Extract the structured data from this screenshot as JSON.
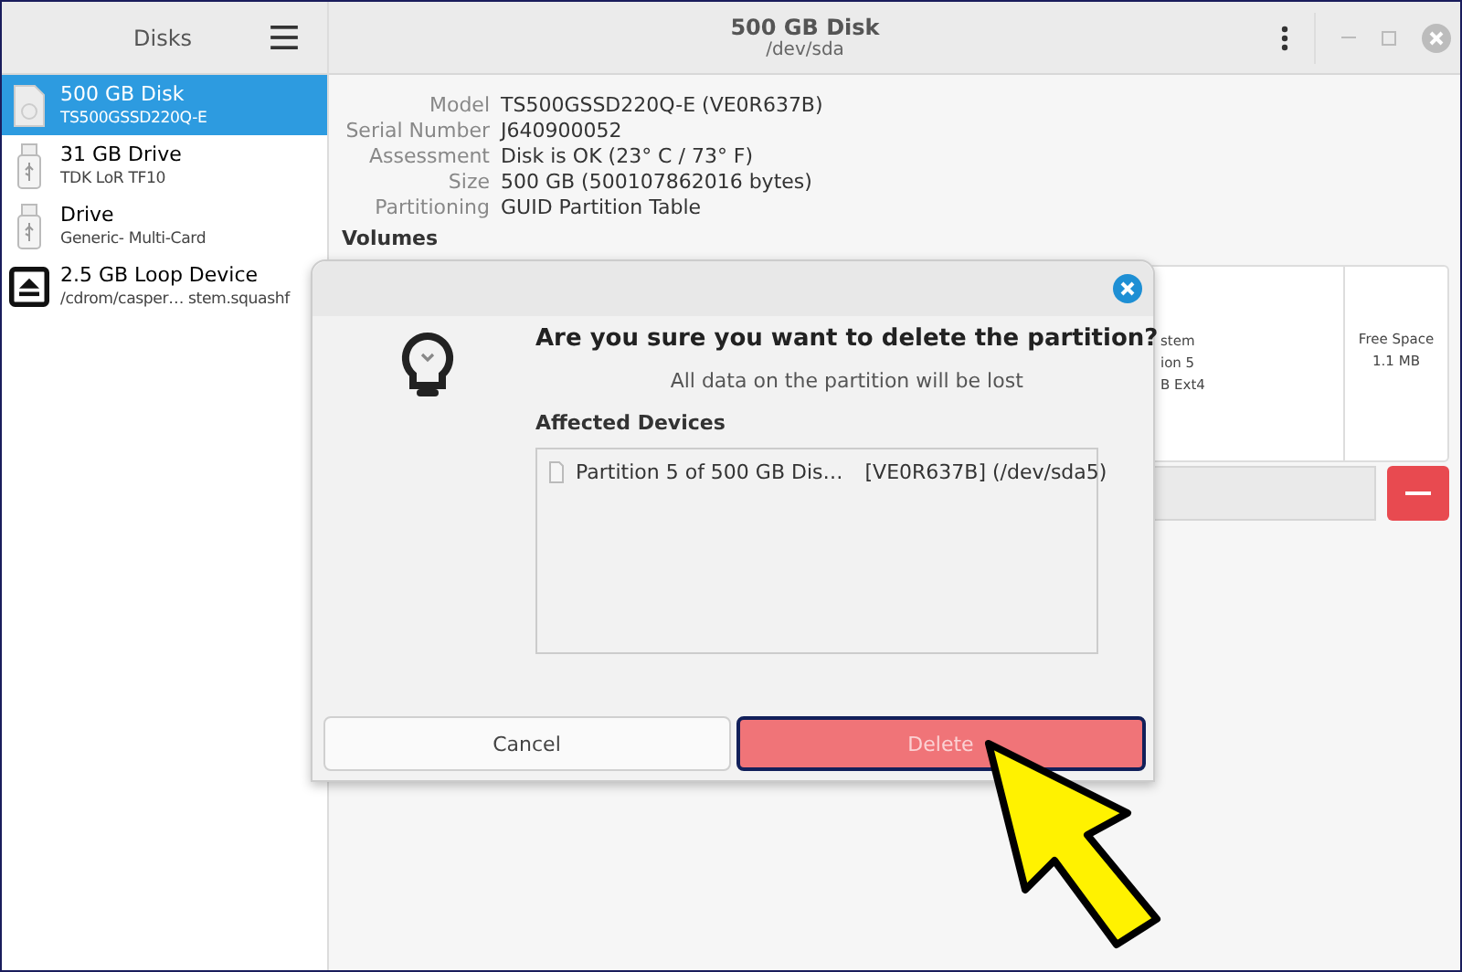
{
  "sidebar": {
    "title": "Disks",
    "items": [
      {
        "kind": "disk",
        "name": "500 GB Disk",
        "detail": "TS500GSSD220Q-E",
        "selected": true
      },
      {
        "kind": "usb",
        "name": "31 GB Drive",
        "detail": "TDK LoR TF10",
        "selected": false
      },
      {
        "kind": "usb",
        "name": "Drive",
        "detail": "Generic- Multi-Card",
        "selected": false
      },
      {
        "kind": "loop",
        "name": "2.5 GB Loop Device",
        "detail": "/cdrom/casper… stem.squashf",
        "selected": false
      }
    ]
  },
  "header": {
    "title": "500 GB Disk",
    "subtitle": "/dev/sda"
  },
  "details": [
    {
      "label": "Model",
      "value": "TS500GSSD220Q-E (VE0R637B)"
    },
    {
      "label": "Serial Number",
      "value": "J640900052"
    },
    {
      "label": "Assessment",
      "value": "Disk is OK (23° C / 73° F)"
    },
    {
      "label": "Size",
      "value": "500 GB (500107862016 bytes)"
    },
    {
      "label": "Partitioning",
      "value": "GUID Partition Table"
    }
  ],
  "volumes": {
    "heading": "Volumes",
    "segments": [
      {
        "lines": [
          "stem",
          "ion 5",
          "B Ext4"
        ]
      },
      {
        "lines": [
          "Free Space",
          "1.1 MB"
        ]
      }
    ]
  },
  "dialog": {
    "question": "Are you sure you want to delete the partition?",
    "message": "All data on the partition will be lost",
    "affected_heading": "Affected Devices",
    "devices": [
      {
        "checked": false,
        "name": "Partition 5 of 500 GB Dis…",
        "id": "[VE0R637B] (/dev/sda5)"
      }
    ],
    "buttons": [
      {
        "kind": "cancel",
        "label": "Cancel"
      },
      {
        "kind": "destructive",
        "label": "Delete"
      }
    ]
  }
}
